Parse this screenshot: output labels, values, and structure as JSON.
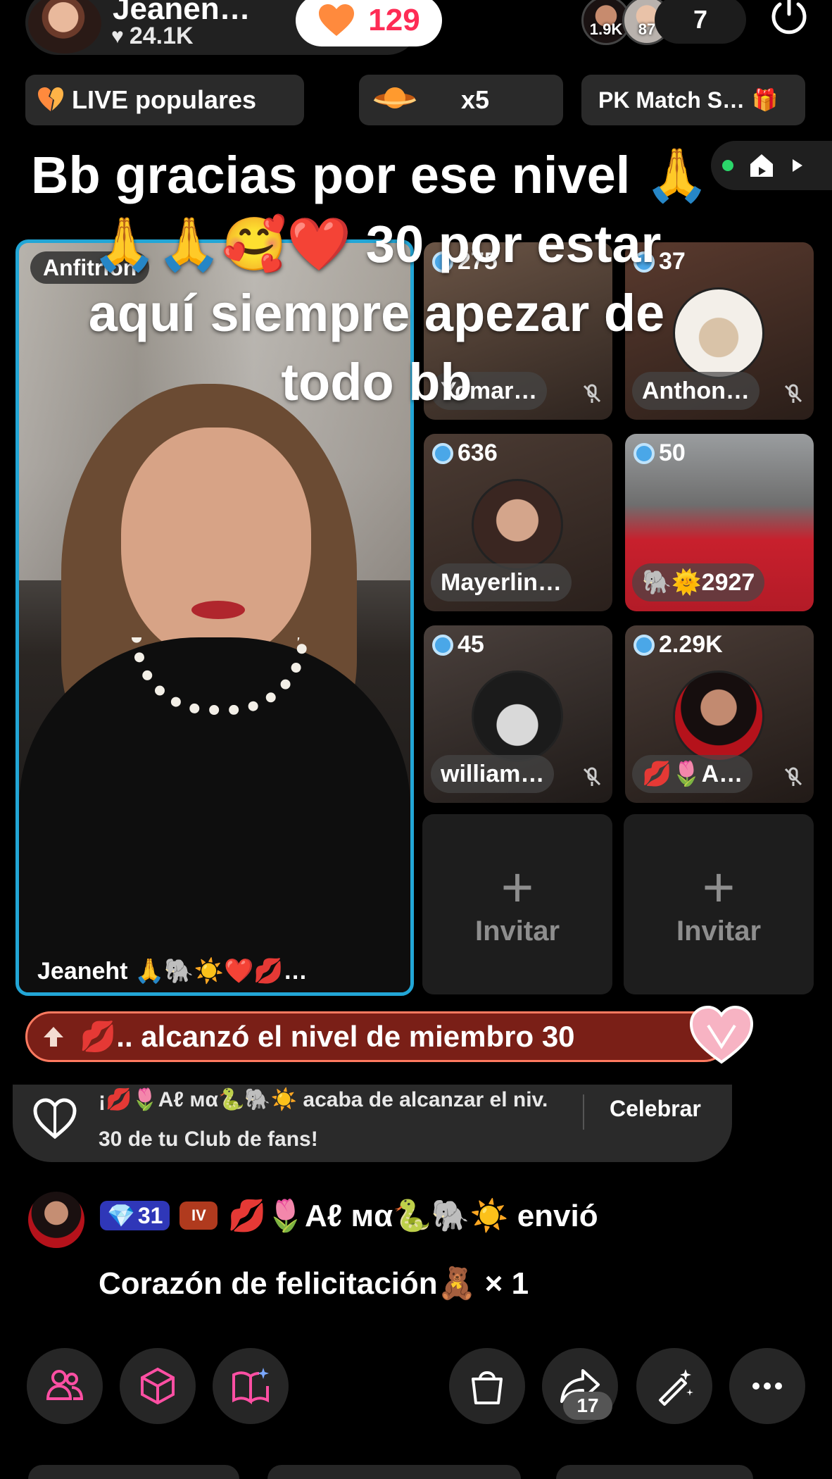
{
  "top_bar": {
    "host_name": "Jeanen…",
    "host_likes": "24.1K",
    "follow_count": "129",
    "viewer_badges": [
      "1.9K",
      "87"
    ],
    "viewer_count": "7"
  },
  "chips": {
    "live_popular": "LIVE populares",
    "multiplier": "x5",
    "pk_match": "PK Match S…"
  },
  "overlay_caption": {
    "line1": "Bb gracias por ese nivel 🙏",
    "line2": "🙏🙏🥰❤️ 30 por estar",
    "line3": "aquí siempre apezar de",
    "line4": "todo bb"
  },
  "host_tile": {
    "role": "Anfitrión",
    "name": "Jeaneht 🙏🐘☀️❤️💋…"
  },
  "guests": [
    {
      "score": "275",
      "name": "Yomar…"
    },
    {
      "score": "37",
      "name": "Anthon…"
    },
    {
      "score": "636",
      "name": "Mayerlin…"
    },
    {
      "score": "50",
      "name": "🐘🌞2927"
    },
    {
      "score": "45",
      "name": "william…"
    },
    {
      "score": "2.29K",
      "name": "💋🌷A…"
    }
  ],
  "invite": {
    "label": "Invitar",
    "plus": "+"
  },
  "level_banner": {
    "text": "💋.. alcanzó el nivel de miembro 30"
  },
  "fan_club": {
    "message": "¡💋🌷Aℓ мα🐍🐘☀️ acaba de alcanzar el niv. 30 de tu Club de fans!",
    "button": "Celebrar"
  },
  "gift_comment": {
    "level": "31",
    "iv": "IV",
    "sender_line": "💋🌷Aℓ мα🐍🐘☀️ envió",
    "gift_line": "Corazón de felicitación🧸 × 1"
  },
  "bottom_bar": {
    "share_count": "17",
    "icons": [
      "people-icon",
      "cube-icon",
      "book-sparkle-icon",
      "shopping-bag-icon",
      "share-icon",
      "magic-wand-icon",
      "more-icon"
    ]
  },
  "colors": {
    "accent_pink": "#fe2c55",
    "host_border": "#22a6d6",
    "banner_bg": "#7a1f17",
    "icon_pink": "#ff4fa3"
  }
}
